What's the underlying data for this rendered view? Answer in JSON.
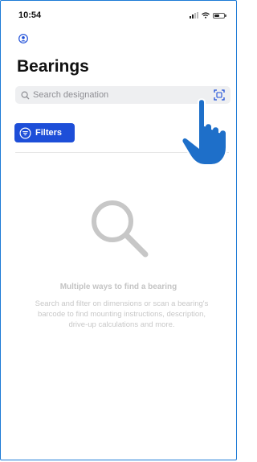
{
  "status_bar": {
    "time": "10:54",
    "battery_level": 0.55
  },
  "page": {
    "title": "Bearings"
  },
  "search": {
    "placeholder": "Search designation",
    "value": ""
  },
  "filters": {
    "label": "Filters"
  },
  "empty_state": {
    "title": "Multiple ways to find a bearing",
    "description": "Search and filter on dimensions or scan a bearing's barcode to find mounting instructions, description, drive-up calculations and more."
  },
  "icons": {
    "profile": "person-circle-icon",
    "search": "magnifier-icon",
    "scan": "barcode-scan-icon",
    "filters": "filter-icon",
    "empty": "magnifier-icon",
    "pointer": "tap-hand-icon"
  },
  "colors": {
    "accent": "#1d4ed8",
    "frame": "#1d7bd6",
    "hand": "#1e6fc9"
  }
}
